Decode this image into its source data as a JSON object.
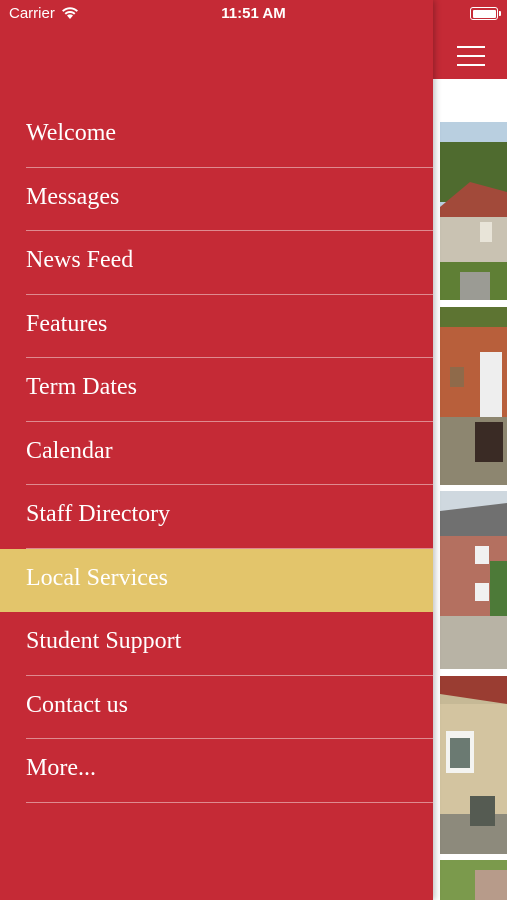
{
  "status_bar": {
    "carrier": "Carrier",
    "time": "11:51 AM"
  },
  "menu": {
    "items": [
      {
        "label": "Welcome"
      },
      {
        "label": "Messages"
      },
      {
        "label": "News Feed"
      },
      {
        "label": "Features"
      },
      {
        "label": "Term Dates"
      },
      {
        "label": "Calendar"
      },
      {
        "label": "Staff Directory"
      },
      {
        "label": "Local Services",
        "selected": true
      },
      {
        "label": "Student Support"
      },
      {
        "label": "Contact us"
      },
      {
        "label": "More..."
      }
    ]
  },
  "colors": {
    "primary_red": "#c52a36",
    "selected_gold": "#e3c56b",
    "text": "#ffffff"
  }
}
